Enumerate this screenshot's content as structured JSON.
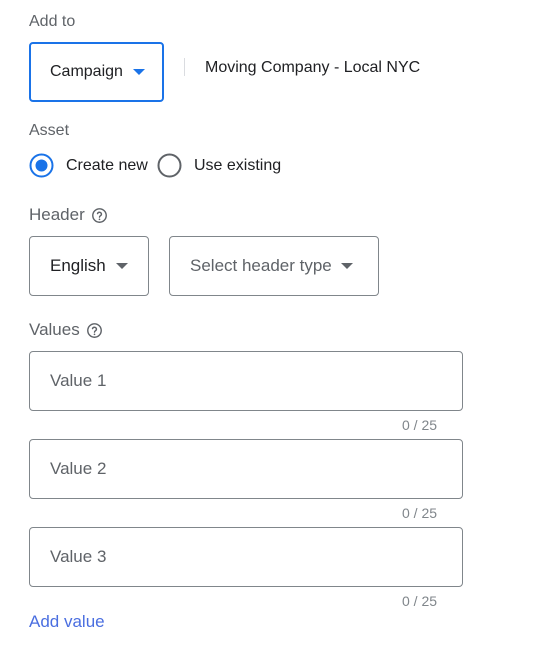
{
  "add_to": {
    "label": "Add to",
    "level_value": "Campaign",
    "campaign_name": "Moving Company - Local NYC"
  },
  "asset": {
    "label": "Asset",
    "options": [
      "Create new",
      "Use existing"
    ],
    "selected": "Create new"
  },
  "header": {
    "label": "Header",
    "language_value": "English",
    "type_placeholder": "Select header type"
  },
  "values": {
    "label": "Values",
    "fields": [
      {
        "placeholder": "Value 1",
        "counter": "0 / 25"
      },
      {
        "placeholder": "Value 2",
        "counter": "0 / 25"
      },
      {
        "placeholder": "Value 3",
        "counter": "0 / 25"
      }
    ],
    "add_value_label": "Add value"
  },
  "colors": {
    "accent": "#1a73e8",
    "link": "#4a6ee0",
    "border": "#80868b",
    "text_secondary": "#5f6368"
  },
  "icons": [
    "chevron-down-icon",
    "help-icon",
    "radio-checked-icon",
    "radio-unchecked-icon"
  ]
}
